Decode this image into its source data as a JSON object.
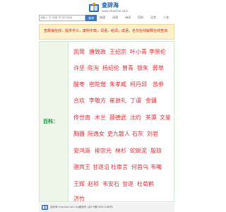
{
  "header": {
    "title": "查辞海",
    "url": "www.chacihai.com"
  },
  "search": {
    "placeholder": "请输入\"字\"或者\"词\"进行查询",
    "button": "查询",
    "categories": [
      "成语",
      "词语",
      "诗词",
      "百科",
      "汉字",
      "人名"
    ]
  },
  "notice": {
    "text": "查辞海在线：提供字义，康熙字典，词语，组词，成语，名句在线解释在线查询"
  },
  "section": {
    "label": "百科："
  },
  "names": [
    [
      "凯莺",
      "唐致政",
      "王绍宗",
      "叶小青",
      "李景伦"
    ],
    [
      "许坚",
      "陈洵",
      "杨绍伦",
      "曾青",
      "银朱",
      "葬草"
    ],
    [
      "酸枣",
      "密陀僧",
      "朱孝臧",
      "柯丹邱",
      "苦参"
    ],
    [
      "合欢",
      "李敬方",
      "崔敦礼",
      "丁谓",
      "金疆"
    ],
    [
      "佟世南",
      "木兰",
      "薛德武",
      "沈约",
      "芙蕖",
      "文鉴"
    ],
    [
      "胸器",
      "阮逸女",
      "史九散人",
      "石灰",
      "刘皂"
    ],
    [
      "安鸿渐",
      "柳宗元",
      "林杉",
      "蛇蜕泥",
      "殷琼"
    ],
    [
      "骆宾王",
      "甘遂沿",
      "杜审言",
      "何首乌",
      "韦曦"
    ],
    [
      "王辉",
      "赵祯",
      "韦安石",
      "甘遂",
      "杜荀鹤"
    ],
    [
      "济竹"
    ]
  ],
  "footer": {
    "text": "查辞海 chacihai.com  Isp备案号  (京ICP备00001168号)"
  },
  "colors": {
    "accent": "#3a78c2",
    "name_text": "#e0303a",
    "notice_bg": "#fff1c9",
    "label_bg": "#eef6ea"
  }
}
